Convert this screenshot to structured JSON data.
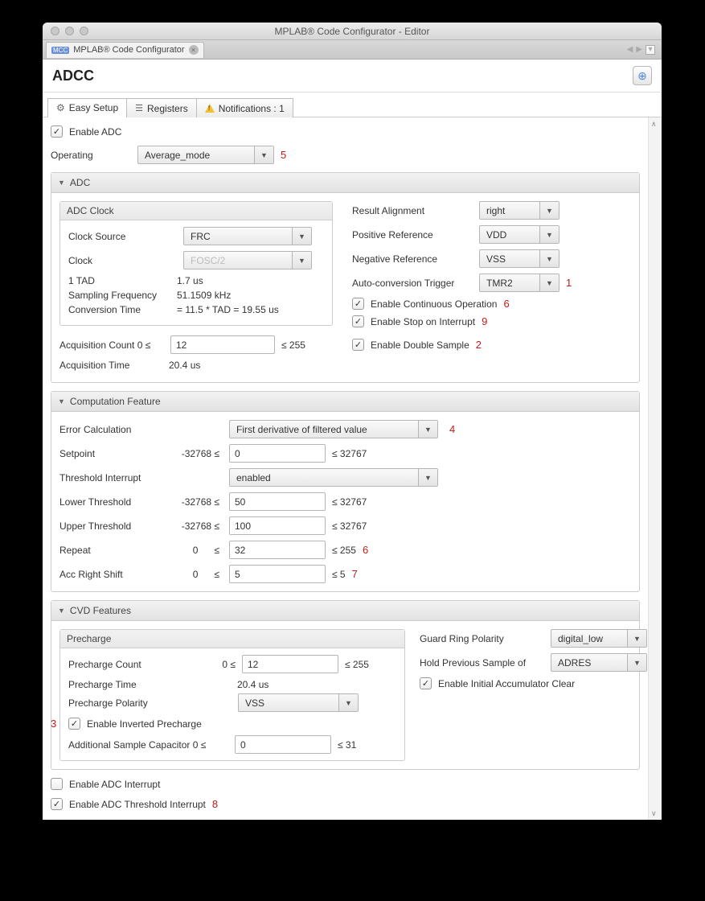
{
  "window": {
    "title": "MPLAB® Code Configurator - Editor",
    "file_tab": "MPLAB® Code Configurator"
  },
  "header": {
    "module_name": "ADCC"
  },
  "subtabs": {
    "easy_setup": "Easy Setup",
    "registers": "Registers",
    "notifications": "Notifications : 1"
  },
  "annotations": {
    "n1": "1",
    "n2": "2",
    "n3": "3",
    "n4": "4",
    "n5": "5",
    "n6": "6",
    "n7": "7",
    "n8": "8",
    "n9": "9"
  },
  "top": {
    "enable_adc": "Enable ADC",
    "operating_label": "Operating",
    "operating_value": "Average_mode"
  },
  "adc_section": {
    "title": "ADC",
    "clock_title": "ADC Clock",
    "clock_source_label": "Clock Source",
    "clock_source_value": "FRC",
    "clock_label": "Clock",
    "clock_value": "FOSC/2",
    "tad_label": "1 TAD",
    "tad_value": "1.7 us",
    "sampling_freq_label": "Sampling Frequency",
    "sampling_freq_value": "51.1509 kHz",
    "conv_time_label": "Conversion Time",
    "conv_time_value": "= 11.5 * TAD =   19.55 us",
    "acq_count_label": "Acquisition Count 0 ≤",
    "acq_count_value": "12",
    "acq_count_max": "≤ 255",
    "acq_time_label": "Acquisition Time",
    "acq_time_value": "20.4 us",
    "result_align_label": "Result Alignment",
    "result_align_value": "right",
    "pos_ref_label": "Positive Reference",
    "pos_ref_value": "VDD",
    "neg_ref_label": "Negative Reference",
    "neg_ref_value": "VSS",
    "auto_conv_label": "Auto-conversion Trigger",
    "auto_conv_value": "TMR2",
    "enable_continuous": "Enable Continuous Operation",
    "enable_stop": "Enable Stop on Interrupt",
    "enable_double": "Enable Double Sample"
  },
  "comp_section": {
    "title": "Computation Feature",
    "err_calc_label": "Error Calculation",
    "err_calc_value": "First derivative of filtered value",
    "setpoint_label": "Setpoint",
    "setpoint_value": "0",
    "thresh_int_label": "Threshold Interrupt",
    "thresh_int_value": "enabled",
    "lower_label": "Lower Threshold",
    "lower_value": "50",
    "upper_label": "Upper Threshold",
    "upper_value": "100",
    "repeat_label": "Repeat",
    "repeat_min": "0",
    "repeat_value": "32",
    "repeat_max": "≤ 255",
    "accrs_label": "Acc Right Shift",
    "accrs_min": "0",
    "accrs_value": "5",
    "accrs_max": "≤ 5",
    "range_neg": "-32768 ≤",
    "range_pos": "≤ 32767",
    "le": "≤"
  },
  "cvd_section": {
    "title": "CVD Features",
    "precharge_title": "Precharge",
    "pre_count_label": "Precharge Count",
    "pre_count_zero": "0 ≤",
    "pre_count_value": "12",
    "pre_count_max": "≤ 255",
    "pre_time_label": "Precharge Time",
    "pre_time_value": "20.4 us",
    "pre_pol_label": "Precharge Polarity",
    "pre_pol_value": "VSS",
    "enable_inverted": "Enable Inverted Precharge",
    "add_cap_label": "Additional Sample Capacitor 0 ≤",
    "add_cap_value": "0",
    "add_cap_max": "≤ 31",
    "guard_label": "Guard Ring Polarity",
    "guard_value": "digital_low",
    "hold_label": "Hold Previous Sample of",
    "hold_value": "ADRES",
    "enable_acc_clear": "Enable Initial Accumulator Clear"
  },
  "bottom": {
    "enable_adc_int": "Enable ADC Interrupt",
    "enable_thresh_int": "Enable ADC Threshold Interrupt"
  }
}
